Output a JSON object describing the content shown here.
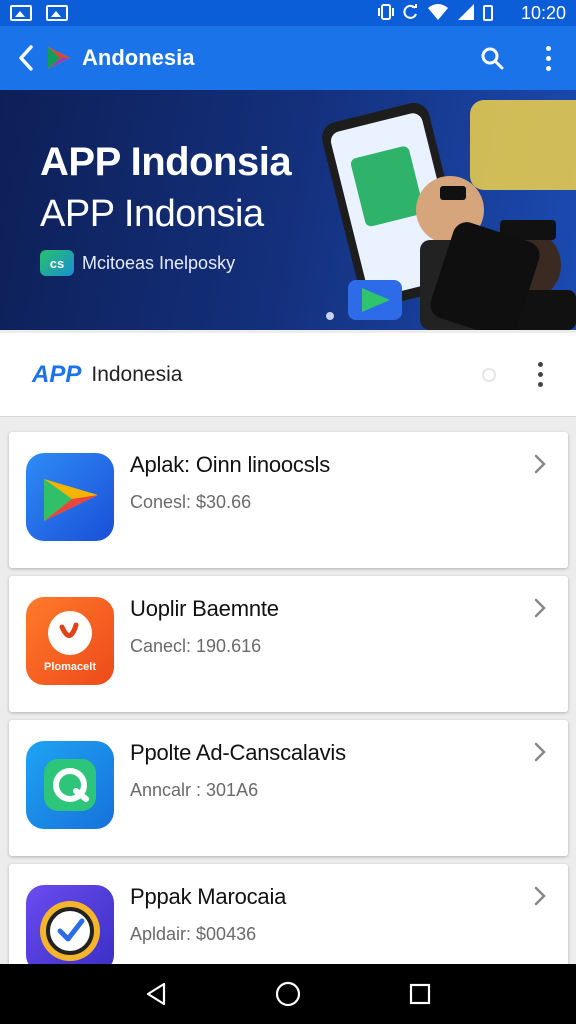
{
  "status_bar": {
    "time": "10:20",
    "icons": [
      "image-icon",
      "gallery-icon",
      "vibrate-icon",
      "sync-icon",
      "wifi-icon",
      "signal-icon",
      "battery-icon"
    ]
  },
  "app_bar": {
    "title": "Andonesia",
    "back_icon": "chevron-left-icon",
    "actions": [
      "search-icon",
      "more-vert-icon"
    ]
  },
  "banner": {
    "title": "APP Indonsia",
    "subtitle": "APP Indonsia",
    "badge": "cs",
    "caption": "Mcitoeas Inelposky"
  },
  "header": {
    "brand": "APP",
    "brand_rest": "Indonesia"
  },
  "apps": [
    {
      "name": "Aplak: Oinn linoocsls",
      "meta": "Conesl: $30.66",
      "icon": "play-store-icon",
      "icon_label": ""
    },
    {
      "name": "Uoplir Baemnte",
      "meta": "Canecl: 190.616",
      "icon": "pizza-icon",
      "icon_label": "Plomacelt"
    },
    {
      "name": "Ppolte Ad-Canscalavis",
      "meta": "Anncalr : 301A6",
      "icon": "chat-icon",
      "icon_label": ""
    },
    {
      "name": "Pppak Marocaia",
      "meta": "Apldair: $00436",
      "icon": "clock-icon",
      "icon_label": ""
    }
  ],
  "colors": {
    "primary": "#1a73e8",
    "status_bar": "#0b5ed7",
    "banner_dark": "#0d1f57"
  }
}
